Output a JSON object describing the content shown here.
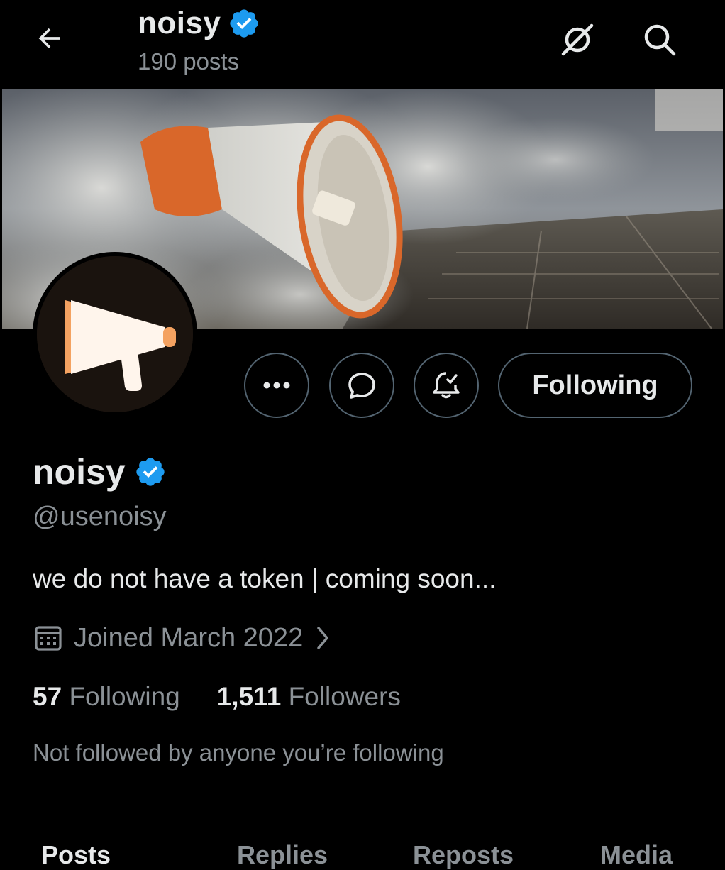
{
  "header": {
    "title": "noisy",
    "posts_count": "190 posts"
  },
  "profile": {
    "name": "noisy",
    "handle": "@usenoisy",
    "bio": "we do not have a token | coming soon...",
    "joined": "Joined March 2022",
    "following_count": "57",
    "following_label": "Following",
    "followers_count": "1,511",
    "followers_label": "Followers",
    "not_followed_text": "Not followed by anyone you’re following"
  },
  "actions": {
    "follow_button_label": "Following"
  },
  "tabs": [
    "Posts",
    "Replies",
    "Reposts",
    "Media"
  ],
  "icons": {
    "back": "arrow-left-icon",
    "grok": "slashed-circle-icon",
    "search": "search-icon",
    "more": "more-dots-icon",
    "message": "message-bubble-icon",
    "notify": "bell-check-icon",
    "verified": "verified-badge-icon",
    "calendar": "calendar-icon",
    "chevron": "chevron-right-icon"
  },
  "colors": {
    "background": "#000000",
    "text_primary": "#e7e9ea",
    "text_secondary": "#8b9196",
    "verified_blue": "#1d9bf0",
    "border": "#536471",
    "brand_orange": "#f4a261"
  }
}
